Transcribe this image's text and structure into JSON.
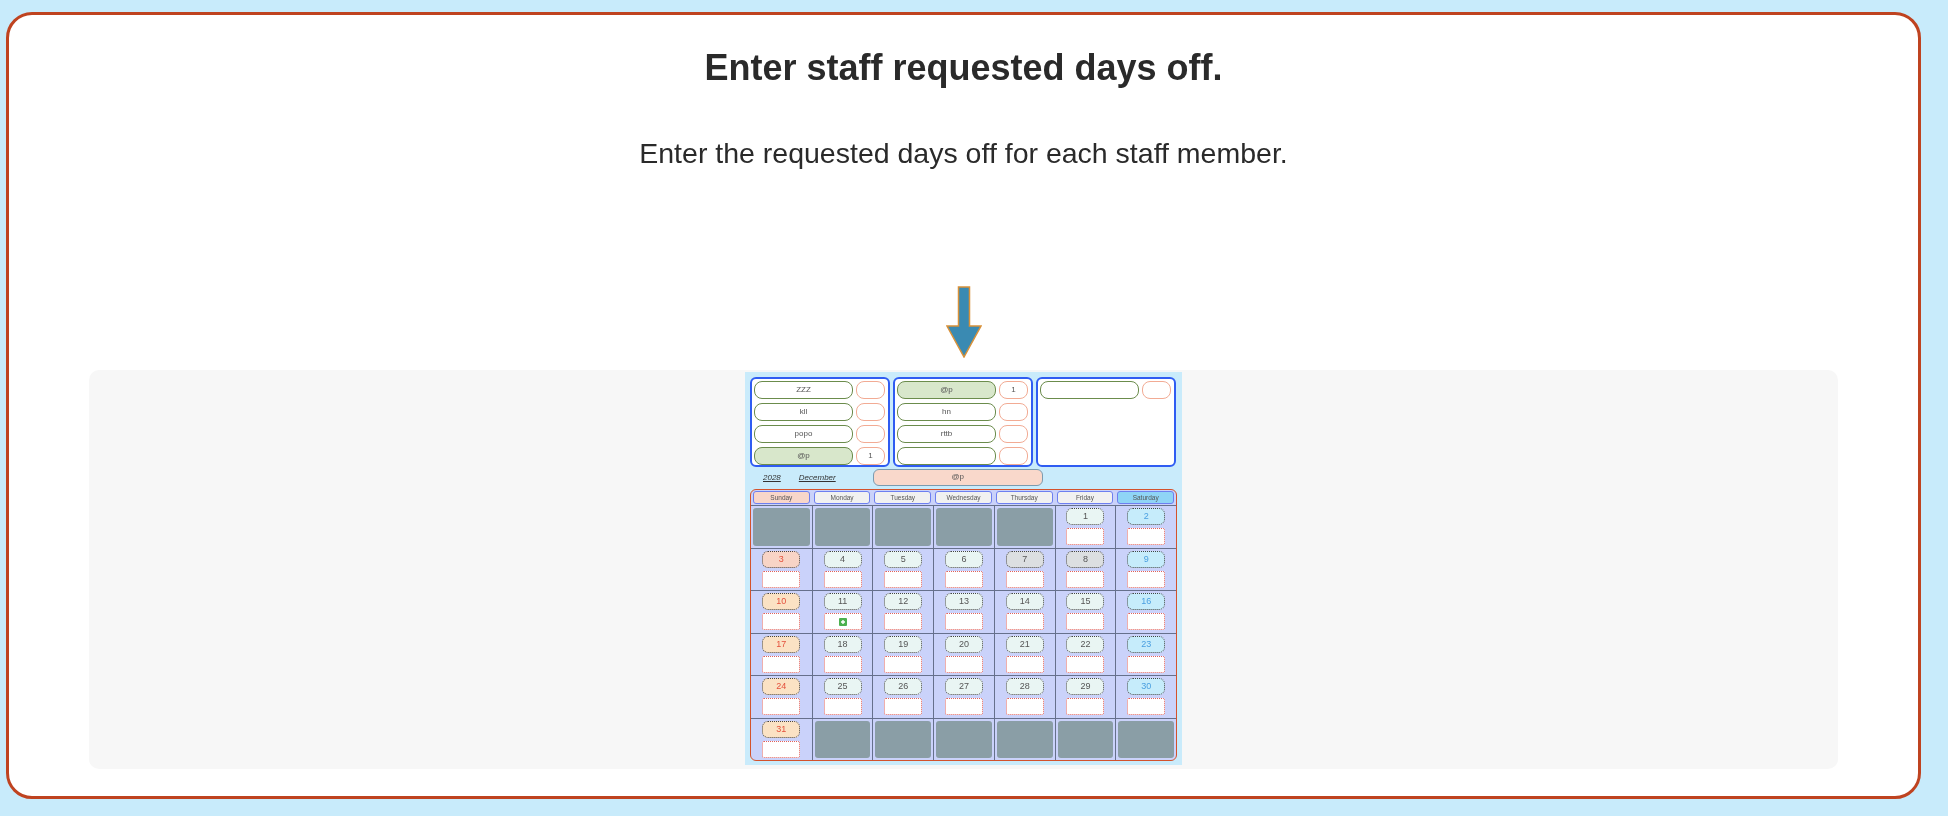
{
  "page": {
    "title": "Enter staff requested days off.",
    "subtitle": "Enter the requested days off for each staff member."
  },
  "preview": {
    "staff_groups": [
      {
        "staff": [
          {
            "name": "ZZZ",
            "selected": false
          },
          {
            "name": "kll",
            "selected": false
          },
          {
            "name": "popo",
            "selected": false
          },
          {
            "name": "@p",
            "selected": true,
            "count": "1"
          }
        ]
      },
      {
        "staff": [
          {
            "name": "@p",
            "selected": true,
            "count": "1"
          },
          {
            "name": "hn",
            "selected": false
          },
          {
            "name": "rttb",
            "selected": false
          },
          {
            "selected": false
          }
        ]
      },
      {
        "staff": [
          {
            "selected": false
          }
        ]
      }
    ],
    "year": "2028",
    "month": "December",
    "current_staff": "@p",
    "weekdays": [
      {
        "label": "Sunday",
        "color": "#f8d6ca"
      },
      {
        "label": "Monday",
        "color": "#f1f1f1"
      },
      {
        "label": "Tuesday",
        "color": "#f1f1f1"
      },
      {
        "label": "Wednesday",
        "color": "#f1f1f1"
      },
      {
        "label": "Thursday",
        "color": "#f1f1f1"
      },
      {
        "label": "Friday",
        "color": "#f1f1f1"
      },
      {
        "label": "Saturday",
        "color": "#8fd4f6"
      }
    ],
    "weeks": [
      [
        {
          "kind": "blank"
        },
        {
          "kind": "blank"
        },
        {
          "kind": "blank"
        },
        {
          "kind": "blank"
        },
        {
          "kind": "blank"
        },
        {
          "kind": "day",
          "day": "1",
          "color": "#e9f5f3",
          "marked": false
        },
        {
          "kind": "day",
          "day": "2",
          "color": "#c6ecfb",
          "marked": false
        }
      ],
      [
        {
          "kind": "day",
          "day": "3",
          "color": "#f8d4c6",
          "marked": false
        },
        {
          "kind": "day",
          "day": "4",
          "color": "#e9f5f3",
          "marked": false
        },
        {
          "kind": "day",
          "day": "5",
          "color": "#e9f5f3",
          "marked": false
        },
        {
          "kind": "day",
          "day": "6",
          "color": "#e9f5f3",
          "marked": false
        },
        {
          "kind": "day",
          "day": "7",
          "color": "#dcdfe1",
          "marked": false
        },
        {
          "kind": "day",
          "day": "8",
          "color": "#dcdfe1",
          "marked": false
        },
        {
          "kind": "day",
          "day": "9",
          "color": "#c6ecfb",
          "marked": false
        }
      ],
      [
        {
          "kind": "day",
          "day": "10",
          "color": "#fbe2c4",
          "marked": false
        },
        {
          "kind": "day",
          "day": "11",
          "color": "#e9f5f3",
          "marked": true
        },
        {
          "kind": "day",
          "day": "12",
          "color": "#e9f5f3",
          "marked": false
        },
        {
          "kind": "day",
          "day": "13",
          "color": "#e9f5f3",
          "marked": false
        },
        {
          "kind": "day",
          "day": "14",
          "color": "#e9f5f3",
          "marked": false
        },
        {
          "kind": "day",
          "day": "15",
          "color": "#e9f5f3",
          "marked": false
        },
        {
          "kind": "day",
          "day": "16",
          "color": "#c6ecfb",
          "marked": false
        }
      ],
      [
        {
          "kind": "day",
          "day": "17",
          "color": "#fbe2c4",
          "marked": false
        },
        {
          "kind": "day",
          "day": "18",
          "color": "#e9f5f3",
          "marked": false
        },
        {
          "kind": "day",
          "day": "19",
          "color": "#e9f5f3",
          "marked": false
        },
        {
          "kind": "day",
          "day": "20",
          "color": "#e9f5f3",
          "marked": false
        },
        {
          "kind": "day",
          "day": "21",
          "color": "#e9f5f3",
          "marked": false
        },
        {
          "kind": "day",
          "day": "22",
          "color": "#e9f5f3",
          "marked": false
        },
        {
          "kind": "day",
          "day": "23",
          "color": "#c6ecfb",
          "marked": false
        }
      ],
      [
        {
          "kind": "day",
          "day": "24",
          "color": "#fbe2c4",
          "marked": false
        },
        {
          "kind": "day",
          "day": "25",
          "color": "#e9f5f3",
          "marked": false
        },
        {
          "kind": "day",
          "day": "26",
          "color": "#e9f5f3",
          "marked": false
        },
        {
          "kind": "day",
          "day": "27",
          "color": "#e9f5f3",
          "marked": false
        },
        {
          "kind": "day",
          "day": "28",
          "color": "#e9f5f3",
          "marked": false
        },
        {
          "kind": "day",
          "day": "29",
          "color": "#e9f5f3",
          "marked": false
        },
        {
          "kind": "day",
          "day": "30",
          "color": "#c6ecfb",
          "marked": false
        }
      ],
      [
        {
          "kind": "day",
          "day": "31",
          "color": "#fbe2c4",
          "marked": false
        },
        {
          "kind": "blank"
        },
        {
          "kind": "blank"
        },
        {
          "kind": "blank"
        },
        {
          "kind": "blank"
        },
        {
          "kind": "blank"
        },
        {
          "kind": "blank"
        }
      ]
    ]
  }
}
